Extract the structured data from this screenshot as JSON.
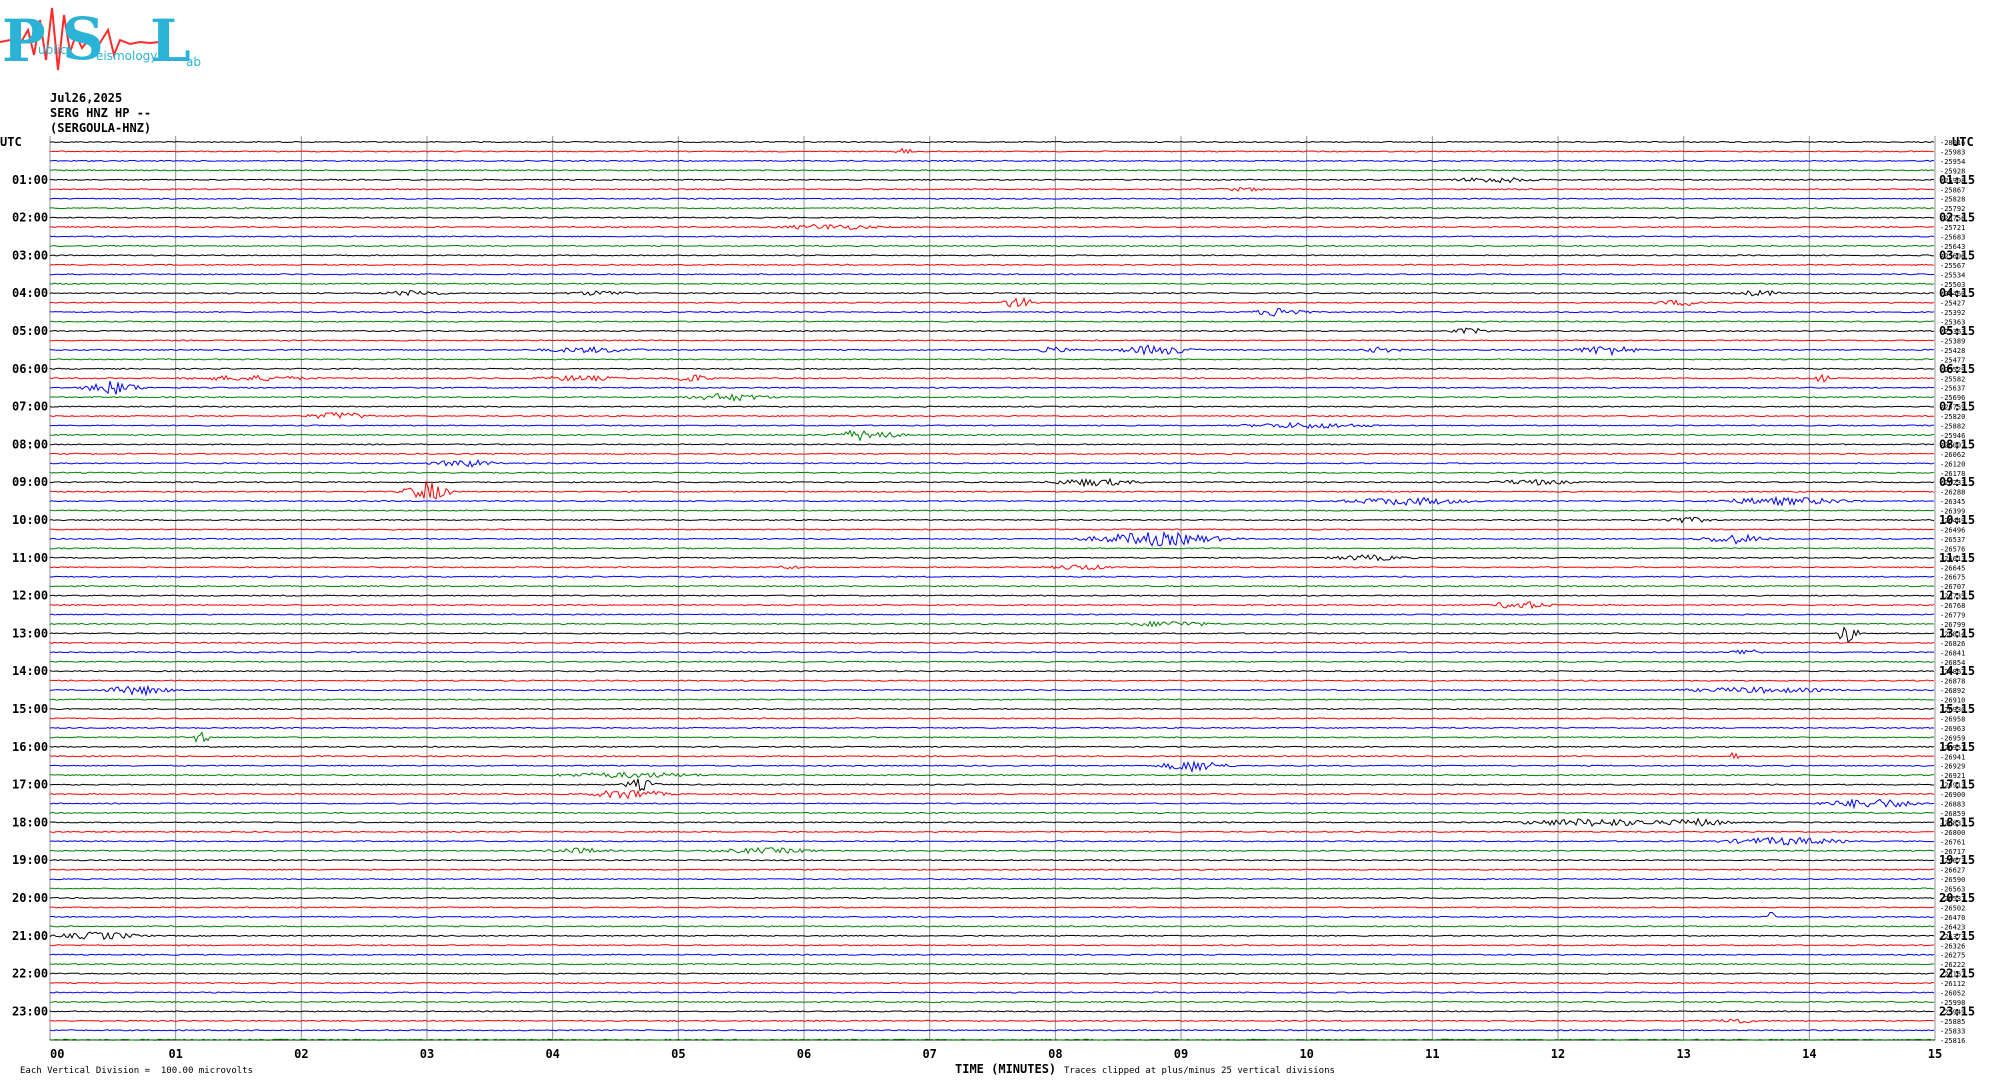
{
  "logo": {
    "letters": [
      "P",
      "S",
      "L"
    ],
    "words": [
      "ublic",
      "eismology",
      "ab"
    ]
  },
  "header": {
    "date": "Jul26,2025",
    "station": "SERG HNZ HP --",
    "station_id": "(SERGOULA-HNZ)"
  },
  "footer": {
    "left_note": "Each Vertical Division =  100.00 microvolts",
    "clip_note": "Traces clipped at plus/minus 25 vertical divisions",
    "x_title": "TIME (MINUTES)"
  },
  "colors": {
    "trace_cycle": [
      "#000000",
      "#ff0000",
      "#0000ff",
      "#008000"
    ],
    "grid": "#909090",
    "logo": "#2ab3d6",
    "logo_trace": "#ff2a2a"
  },
  "chart_data": {
    "type": "line",
    "title": "",
    "xlabel": "TIME (MINUTES)",
    "xlim": [
      0,
      15
    ],
    "x_ticks": [
      "00",
      "01",
      "02",
      "03",
      "04",
      "05",
      "06",
      "07",
      "08",
      "09",
      "10",
      "11",
      "12",
      "13",
      "14",
      "15"
    ],
    "left_axis_label": "UTC",
    "right_axis_label": "UTC",
    "left_hour_labels": [
      "01:00",
      "02:00",
      "03:00",
      "04:00",
      "05:00",
      "06:00",
      "07:00",
      "08:00",
      "09:00",
      "10:00",
      "11:00",
      "12:00",
      "13:00",
      "14:00",
      "15:00",
      "16:00",
      "17:00",
      "18:00",
      "19:00",
      "20:00",
      "21:00",
      "22:00",
      "23:00"
    ],
    "right_hour_labels": [
      "01:15",
      "02:15",
      "03:15",
      "04:15",
      "05:15",
      "06:15",
      "07:15",
      "08:15",
      "09:15",
      "10:15",
      "11:15",
      "12:15",
      "13:15",
      "14:15",
      "15:15",
      "16:15",
      "17:15",
      "18:15",
      "19:15",
      "20:15",
      "21:15",
      "22:15",
      "23:15"
    ],
    "trace_count": 96,
    "trace_minutes": 15,
    "trace_offsets": [
      "-28016",
      "-25983",
      "-25954",
      "-25928",
      "-25908",
      "-25867",
      "-25828",
      "-25792",
      "-25756",
      "-25721",
      "-25683",
      "-25643",
      "-25606",
      "-25567",
      "-25534",
      "-25503",
      "-25460",
      "-25427",
      "-25392",
      "-25363",
      "-25363",
      "-25389",
      "-25428",
      "-25477",
      "-25529",
      "-25582",
      "-25637",
      "-25696",
      "-25759",
      "-25820",
      "-25882",
      "-25946",
      "-26007",
      "-26062",
      "-26120",
      "-26178",
      "-26233",
      "-26288",
      "-26345",
      "-26399",
      "-26449",
      "-26496",
      "-26537",
      "-26576",
      "-26613",
      "-26645",
      "-26675",
      "-26707",
      "-26735",
      "-26768",
      "-26779",
      "-26799",
      "-26814",
      "-26826",
      "-26841",
      "-26854",
      "-26867",
      "-26878",
      "-26892",
      "-26910",
      "-26930",
      "-26958",
      "-26963",
      "-26959",
      "-26951",
      "-26941",
      "-26929",
      "-26921",
      "-26913",
      "-26900",
      "-26883",
      "-26859",
      "-26833",
      "-26800",
      "-26761",
      "-26717",
      "-26673",
      "-26627",
      "-26590",
      "-26563",
      "-26531",
      "-26502",
      "-26470",
      "-26423",
      "-26373",
      "-26326",
      "-26275",
      "-26222",
      "-26167",
      "-26112",
      "-26052",
      "-25998",
      "-25949",
      "-25885",
      "-25833",
      "-25816"
    ],
    "events": [
      {
        "trace": 1,
        "minute": 6.8,
        "amp": 3,
        "width": 0.2
      },
      {
        "trace": 4,
        "minute": 11.5,
        "amp": 3,
        "width": 0.8
      },
      {
        "trace": 5,
        "minute": 9.5,
        "amp": 2,
        "width": 0.6
      },
      {
        "trace": 9,
        "minute": 6.2,
        "amp": 3,
        "width": 1.0
      },
      {
        "trace": 16,
        "minute": 2.9,
        "amp": 3,
        "width": 0.6
      },
      {
        "trace": 16,
        "minute": 4.4,
        "amp": 2.5,
        "width": 0.7
      },
      {
        "trace": 16,
        "minute": 13.6,
        "amp": 3,
        "width": 0.5
      },
      {
        "trace": 17,
        "minute": 7.7,
        "amp": 6,
        "width": 0.3
      },
      {
        "trace": 17,
        "minute": 13.0,
        "amp": 3,
        "width": 0.6
      },
      {
        "trace": 18,
        "minute": 9.8,
        "amp": 5,
        "width": 0.5
      },
      {
        "trace": 20,
        "minute": 11.3,
        "amp": 3,
        "width": 0.4
      },
      {
        "trace": 22,
        "minute": 4.3,
        "amp": 3,
        "width": 1.0
      },
      {
        "trace": 22,
        "minute": 8.0,
        "amp": 3,
        "width": 0.4
      },
      {
        "trace": 22,
        "minute": 8.8,
        "amp": 5,
        "width": 0.7
      },
      {
        "trace": 22,
        "minute": 10.6,
        "amp": 3,
        "width": 0.4
      },
      {
        "trace": 22,
        "minute": 12.4,
        "amp": 5,
        "width": 0.6
      },
      {
        "trace": 25,
        "minute": 1.6,
        "amp": 3,
        "width": 1.2
      },
      {
        "trace": 25,
        "minute": 4.2,
        "amp": 3,
        "width": 0.8
      },
      {
        "trace": 25,
        "minute": 5.1,
        "amp": 4,
        "width": 0.4
      },
      {
        "trace": 25,
        "minute": 14.1,
        "amp": 5,
        "width": 0.15
      },
      {
        "trace": 26,
        "minute": 0.5,
        "amp": 7,
        "width": 0.5
      },
      {
        "trace": 27,
        "minute": 5.4,
        "amp": 4,
        "width": 0.8
      },
      {
        "trace": 29,
        "minute": 2.3,
        "amp": 4,
        "width": 0.6
      },
      {
        "trace": 30,
        "minute": 10.0,
        "amp": 3,
        "width": 1.3
      },
      {
        "trace": 31,
        "minute": 6.5,
        "amp": 6,
        "width": 0.6
      },
      {
        "trace": 34,
        "minute": 3.3,
        "amp": 4,
        "width": 0.6
      },
      {
        "trace": 36,
        "minute": 8.3,
        "amp": 4,
        "width": 0.8
      },
      {
        "trace": 36,
        "minute": 11.8,
        "amp": 3,
        "width": 0.8
      },
      {
        "trace": 37,
        "minute": 3.0,
        "amp": 10,
        "width": 0.4
      },
      {
        "trace": 38,
        "minute": 10.8,
        "amp": 4,
        "width": 1.2
      },
      {
        "trace": 38,
        "minute": 13.8,
        "amp": 4,
        "width": 1.3
      },
      {
        "trace": 40,
        "minute": 13.0,
        "amp": 3,
        "width": 0.6
      },
      {
        "trace": 42,
        "minute": 8.8,
        "amp": 7,
        "width": 1.2
      },
      {
        "trace": 42,
        "minute": 13.4,
        "amp": 5,
        "width": 0.6
      },
      {
        "trace": 44,
        "minute": 10.5,
        "amp": 3,
        "width": 0.8
      },
      {
        "trace": 45,
        "minute": 8.2,
        "amp": 3,
        "width": 0.6
      },
      {
        "trace": 45,
        "minute": 5.9,
        "amp": 2,
        "width": 0.3
      },
      {
        "trace": 49,
        "minute": 11.7,
        "amp": 4,
        "width": 0.6
      },
      {
        "trace": 51,
        "minute": 8.9,
        "amp": 3,
        "width": 0.9
      },
      {
        "trace": 52,
        "minute": 14.3,
        "amp": 10,
        "width": 0.2
      },
      {
        "trace": 54,
        "minute": 13.5,
        "amp": 4,
        "width": 0.3
      },
      {
        "trace": 58,
        "minute": 0.7,
        "amp": 5,
        "width": 0.6
      },
      {
        "trace": 58,
        "minute": 13.6,
        "amp": 3,
        "width": 1.5
      },
      {
        "trace": 63,
        "minute": 1.2,
        "amp": 8,
        "width": 0.15
      },
      {
        "trace": 65,
        "minute": 13.4,
        "amp": 6,
        "width": 0.08
      },
      {
        "trace": 66,
        "minute": 9.1,
        "amp": 6,
        "width": 0.6
      },
      {
        "trace": 67,
        "minute": 4.6,
        "amp": 3,
        "width": 1.5
      },
      {
        "trace": 68,
        "minute": 4.7,
        "amp": 6,
        "width": 0.3
      },
      {
        "trace": 69,
        "minute": 4.6,
        "amp": 5,
        "width": 0.7
      },
      {
        "trace": 70,
        "minute": 14.5,
        "amp": 5,
        "width": 0.9
      },
      {
        "trace": 72,
        "minute": 12.3,
        "amp": 4,
        "width": 1.5
      },
      {
        "trace": 72,
        "minute": 13.1,
        "amp": 4,
        "width": 0.7
      },
      {
        "trace": 74,
        "minute": 13.8,
        "amp": 4,
        "width": 1.2
      },
      {
        "trace": 75,
        "minute": 4.2,
        "amp": 3,
        "width": 0.6
      },
      {
        "trace": 75,
        "minute": 5.7,
        "amp": 3,
        "width": 1.0
      },
      {
        "trace": 82,
        "minute": 13.7,
        "amp": 5,
        "width": 0.15
      },
      {
        "trace": 84,
        "minute": 0.4,
        "amp": 4,
        "width": 0.8
      },
      {
        "trace": 93,
        "minute": 13.4,
        "amp": 3,
        "width": 0.4
      }
    ]
  }
}
